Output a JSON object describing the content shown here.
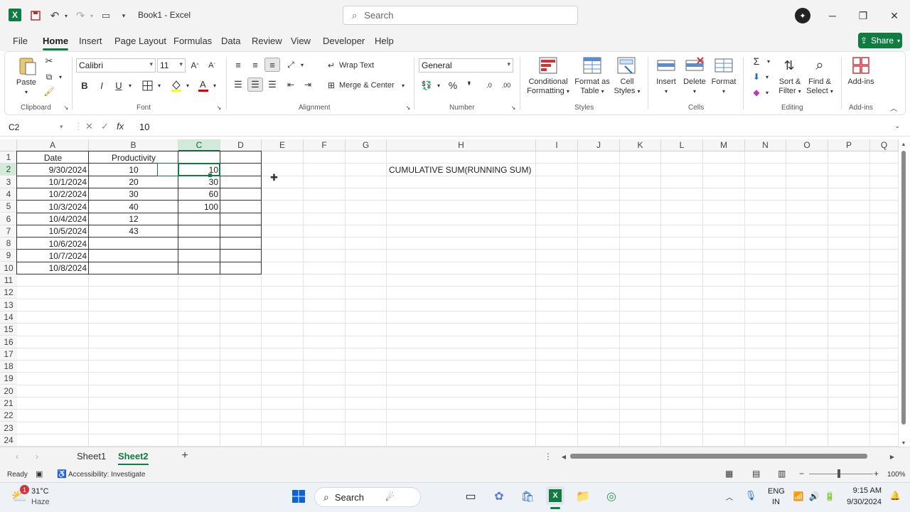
{
  "app": {
    "title": "Book1  -  Excel",
    "search_placeholder": "Search",
    "logo_letter": "X",
    "avatar_glyph": "✦"
  },
  "menu": {
    "tabs": [
      "File",
      "Home",
      "Insert",
      "Page Layout",
      "Formulas",
      "Data",
      "Review",
      "View",
      "Developer",
      "Help"
    ],
    "active": "Home",
    "share_label": "Share"
  },
  "ribbon": {
    "clipboard": {
      "paste": "Paste",
      "label": "Clipboard"
    },
    "font": {
      "name": "Calibri",
      "size": "11",
      "label": "Font",
      "bold": "B",
      "italic": "I",
      "underline": "U"
    },
    "alignment": {
      "wrap": "Wrap Text",
      "merge": "Merge & Center",
      "label": "Alignment"
    },
    "number": {
      "format": "General",
      "label": "Number"
    },
    "styles": {
      "conditional": "Conditional",
      "conditional2": "Formatting",
      "format_as": "Format as",
      "format_as2": "Table",
      "cell": "Cell",
      "cell2": "Styles",
      "label": "Styles"
    },
    "cells": {
      "insert": "Insert",
      "delete": "Delete",
      "format": "Format",
      "label": "Cells"
    },
    "editing": {
      "sort": "Sort &",
      "sort2": "Filter",
      "find": "Find &",
      "find2": "Select",
      "label": "Editing"
    },
    "addins": {
      "btn": "Add-ins",
      "label": "Add-ins"
    }
  },
  "formula_bar": {
    "name_box": "C2",
    "value": "10"
  },
  "grid": {
    "columns": [
      "A",
      "B",
      "C",
      "D",
      "E",
      "F",
      "G",
      "H",
      "I",
      "J",
      "K",
      "L",
      "M",
      "N",
      "O",
      "P",
      "Q"
    ],
    "rows": [
      "1",
      "2",
      "3",
      "4",
      "5",
      "6",
      "7",
      "8",
      "9",
      "10",
      "11",
      "12",
      "13",
      "14",
      "15",
      "16",
      "17",
      "18",
      "19",
      "20",
      "21",
      "22",
      "23",
      "24"
    ],
    "selected_cell": "C2",
    "table": {
      "header_a": "Date",
      "header_b": "Productivity",
      "dates": [
        "9/30/2024",
        "10/1/2024",
        "10/2/2024",
        "10/3/2024",
        "10/4/2024",
        "10/5/2024",
        "10/6/2024",
        "10/7/2024",
        "10/8/2024"
      ],
      "productivity": [
        "10",
        "20",
        "30",
        "40",
        "12",
        "43",
        "",
        "",
        ""
      ],
      "cumulative": [
        "10",
        "30",
        "60",
        "100",
        "",
        "",
        "",
        "",
        ""
      ]
    },
    "note_h2": "CUMULATIVE SUM(RUNNING SUM)"
  },
  "sheets": {
    "tabs": [
      "Sheet1",
      "Sheet2"
    ],
    "active": "Sheet2",
    "add": "+"
  },
  "status": {
    "ready": "Ready",
    "accessibility": "Accessibility: Investigate",
    "zoom": "100%"
  },
  "taskbar": {
    "weather_temp": "31°C",
    "weather_desc": "Haze",
    "weather_badge": "1",
    "search": "Search",
    "lang1": "ENG",
    "lang2": "IN",
    "time": "9:15 AM",
    "date": "9/30/2024"
  },
  "colors": {
    "accent": "#107c41",
    "ribbon_bg": "#ffffff",
    "chrome_bg": "#f3f3f3"
  }
}
